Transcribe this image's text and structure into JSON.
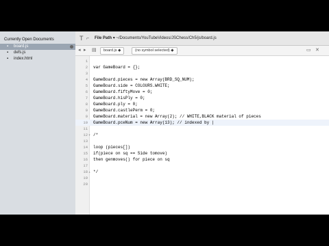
{
  "sidebar": {
    "header": "Currently Open Documents",
    "items": [
      {
        "label": "board.js",
        "active": true
      },
      {
        "label": "defs.js",
        "active": false
      },
      {
        "label": "index.html",
        "active": false
      }
    ]
  },
  "toolbar": {
    "filepath_label": "File Path",
    "filepath_value": "~/Documents/YouTubeVideos/JSChess/Ch5/js/board.js"
  },
  "subbar": {
    "file_tab": "board.js",
    "symbol_selector": "(no symbol selected)"
  },
  "editor": {
    "lines": [
      {
        "n": "1",
        "text": ""
      },
      {
        "n": "2",
        "text": "var GameBoard = {};"
      },
      {
        "n": "3",
        "text": ""
      },
      {
        "n": "4",
        "text": "GameBoard.pieces = new Array(BRD_SQ_NUM);"
      },
      {
        "n": "5",
        "text": "GameBoard.side = COLOURS.WHITE;"
      },
      {
        "n": "6",
        "text": "GameBoard.fiftyMove = 0;"
      },
      {
        "n": "7",
        "text": "GameBoard.hisPly = 0;"
      },
      {
        "n": "8",
        "text": "GameBoard.ply = 0;"
      },
      {
        "n": "9",
        "text": "GameBoard.castlePerm = 0;"
      },
      {
        "n": "9",
        "text": "GameBoard.material = new Array(2); // WHITE,BLACK material of pieces"
      },
      {
        "n": "10",
        "text": "GameBoard.pceNum = new Array(13); // indexed by |"
      },
      {
        "n": "11",
        "text": ""
      },
      {
        "n": "12",
        "text": "/*"
      },
      {
        "n": "13",
        "text": ""
      },
      {
        "n": "14",
        "text": "loop (pieces[])"
      },
      {
        "n": "15",
        "text": "if(piece on sq == Side tomove)"
      },
      {
        "n": "16",
        "text": "then genmoves() for piece on sq"
      },
      {
        "n": "17",
        "text": ""
      },
      {
        "n": "18",
        "text": "*/"
      },
      {
        "n": "19",
        "text": ""
      },
      {
        "n": "20",
        "text": ""
      }
    ]
  },
  "colors": {
    "sidebar_bg": "#d9dde2",
    "active_item": "#9aa5b2",
    "current_line": "#eef3fb",
    "keyword": "#8a2a7d"
  }
}
